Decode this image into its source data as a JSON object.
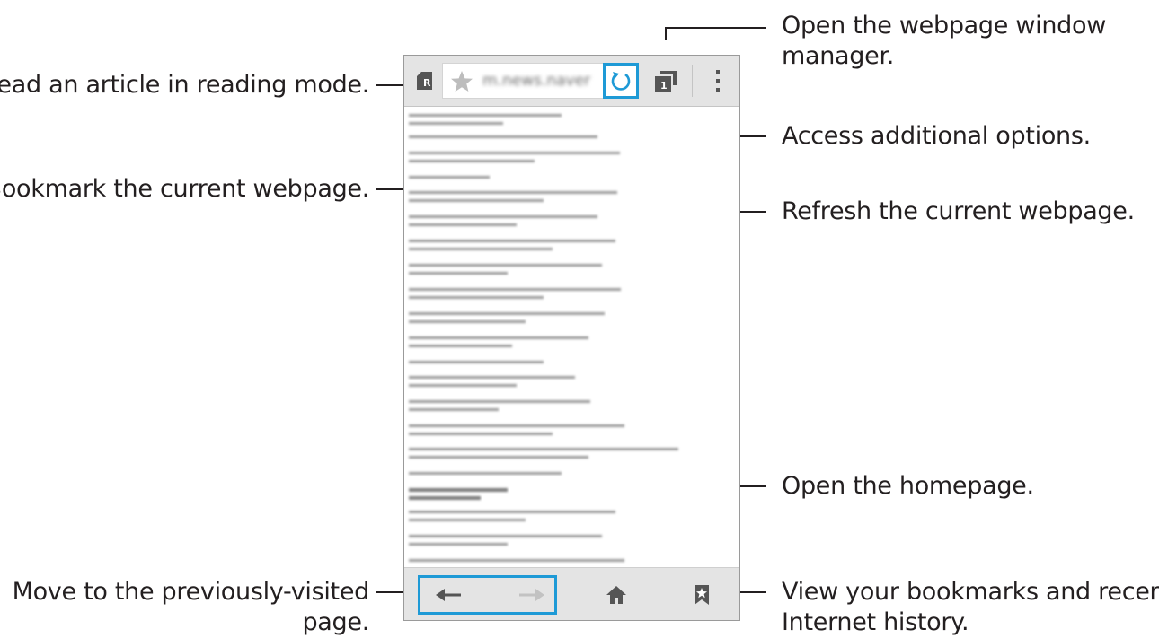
{
  "callouts": {
    "reading_mode": "Read an article in reading mode.",
    "bookmark_page": "Bookmark the current webpage.",
    "previous_page_1": "Move to the previously-visited",
    "previous_page_2": "page.",
    "window_manager_1": "Open the webpage window",
    "window_manager_2": "manager.",
    "additional_options": "Access additional options.",
    "refresh": "Refresh the current webpage.",
    "homepage": "Open the homepage.",
    "bookmarks_history_1": "View your bookmarks and recent",
    "bookmarks_history_2": "Internet history."
  },
  "browser": {
    "url": "m.news.naver",
    "reading_mode_badge": "R",
    "window_count": "1"
  },
  "icons": {
    "reading_mode": "reading-mode-icon",
    "bookmark_star": "star-icon",
    "refresh": "refresh-icon",
    "windows": "window-manager-icon",
    "more": "more-vertical-icon",
    "back": "arrow-left-icon",
    "forward": "arrow-right-icon",
    "home": "home-icon",
    "bookmarks": "bookmarks-icon"
  },
  "colors": {
    "highlight": "#1e9ad6",
    "toolbar": "#e4e4e4",
    "icon": "#555555",
    "text": "#231f20"
  }
}
